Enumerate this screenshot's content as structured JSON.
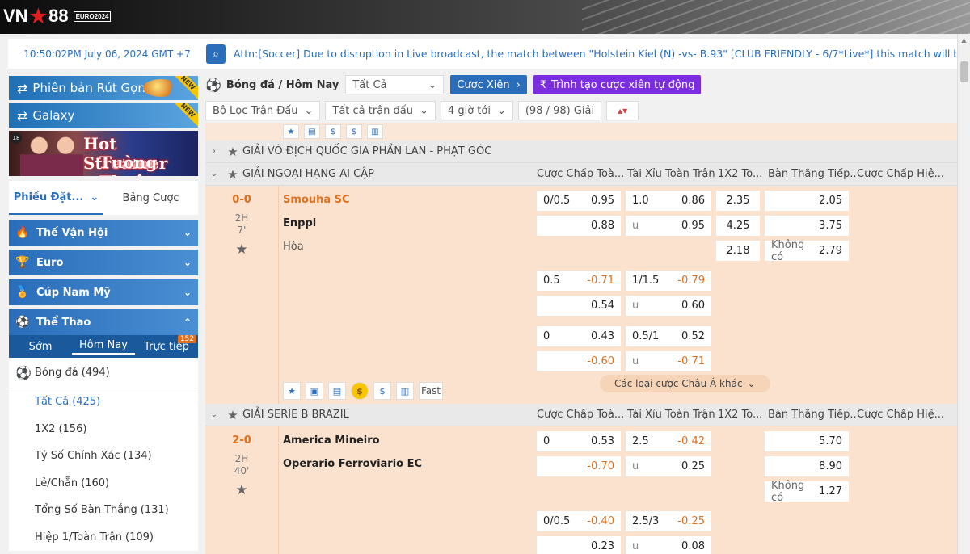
{
  "brand": {
    "logo_text": "VN",
    "logo_num": "88",
    "euro_badge": "EURO2024"
  },
  "header": {
    "clock": "10:50:02PM July 06, 2024 GMT +7",
    "marquee": "Attn:[Soccer] Due to disruption in Live broadcast, the match between \"Holstein Kiel (N) -vs- B.93\" [CLUB FRIENDLY - 6/7*Live*] this match will be removed"
  },
  "sidebar": {
    "promo1": "Phiên bản Rút Gọn",
    "promo2": "Galaxy",
    "new_label": "NEW",
    "streamer_line1": "Hot Streamer",
    "streamer_line2": "Tường Thuật",
    "slip_tab": "Phiếu Đặt...",
    "bets_tab": "Bảng Cược",
    "categories": [
      {
        "label": "Thế Vận Hội",
        "icon": "torch-icon"
      },
      {
        "label": "Euro",
        "icon": "trophy-icon"
      },
      {
        "label": "Cúp Nam Mỹ",
        "icon": "cup-icon"
      },
      {
        "label": "Thể Thao",
        "icon": "soccer-ball-icon"
      }
    ],
    "subtabs": [
      "Sớm",
      "Hôm Nay",
      "Trực tiếp"
    ],
    "live_count": "152",
    "sport": "Bóng đá",
    "sport_count": "(494)",
    "markets": [
      {
        "label": "Tất Cả",
        "count": "(425)"
      },
      {
        "label": "1X2",
        "count": "(156)"
      },
      {
        "label": "Tỷ Số Chính Xác",
        "count": "(134)"
      },
      {
        "label": "Lẻ/Chẵn",
        "count": "(160)"
      },
      {
        "label": "Tổng Số Bàn Thắng",
        "count": "(131)"
      },
      {
        "label": "Hiệp 1/Toàn Trận",
        "count": "(109)"
      }
    ]
  },
  "main": {
    "title": "Bóng đá / Hôm Nay",
    "filter_all": "Tất Cả",
    "parlay_btn": "Cược Xiên",
    "auto_parlay_btn": "Trình tạo cược xiên tự động",
    "filter_match": "Bộ Lọc Trận Đấu",
    "all_matches": "Tất cả trận đấu",
    "hours": "4 giờ tới",
    "leagues_count": "(98 / 98) Giải",
    "headers": [
      "Cược Chấp Toà...",
      "Tài Xỉu Toàn Trận",
      "1X2 To...",
      "Bàn Thắng Tiếp...",
      "Cược Chấp Hiệ..."
    ],
    "league1": "GIẢI VÔ ĐỊCH QUỐC GIA PHẦN LAN - PHẠT GÓC",
    "league2": "GIẢI NGOẠI HẠNG AI CẬP",
    "league3": "GIẢI SERIE B BRAZIL",
    "match1": {
      "score": "0-0",
      "period": "2H",
      "minute": "7'",
      "home": "Smouha SC",
      "away": "Enppi",
      "draw": "Hòa",
      "r1": {
        "h_line": "0/0.5",
        "h_odd": "0.95",
        "t_line": "1.0",
        "t_odd": "0.86",
        "x": "2.35",
        "b": "2.05"
      },
      "r2": {
        "h_odd": "0.88",
        "t_line": "u",
        "t_odd": "0.95",
        "x": "4.25",
        "b": "3.75"
      },
      "r3": {
        "x": "2.18",
        "b_label": "Không có",
        "b": "2.79"
      },
      "r4": {
        "h_line": "0.5",
        "h_odd": "-0.71",
        "t_line": "1/1.5",
        "t_odd": "-0.79"
      },
      "r5": {
        "h_odd": "0.54",
        "t_line": "u",
        "t_odd": "0.60"
      },
      "r6": {
        "h_line": "0",
        "h_odd": "0.43",
        "t_line": "0.5/1",
        "t_odd": "0.52"
      },
      "r7": {
        "h_odd": "-0.60",
        "t_line": "u",
        "t_odd": "-0.71"
      },
      "fast": "Fast",
      "more": "Các loại cược Châu Á khác"
    },
    "match2": {
      "score": "2-0",
      "period": "2H",
      "minute": "40'",
      "home": "America Mineiro",
      "away": "Operario Ferroviario EC",
      "r1": {
        "h_line": "0",
        "h_odd": "0.53",
        "t_line": "2.5",
        "t_odd": "-0.42",
        "b": "5.70"
      },
      "r2": {
        "h_odd": "-0.70",
        "t_line": "u",
        "t_odd": "0.25",
        "b": "8.90"
      },
      "r3": {
        "b_label": "Không có",
        "b": "1.27"
      },
      "r4": {
        "h_line": "0/0.5",
        "h_odd": "-0.40",
        "t_line": "2.5/3",
        "t_odd": "-0.25"
      },
      "r5": {
        "h_odd": "0.23",
        "t_line": "u",
        "t_odd": "0.08"
      }
    }
  }
}
